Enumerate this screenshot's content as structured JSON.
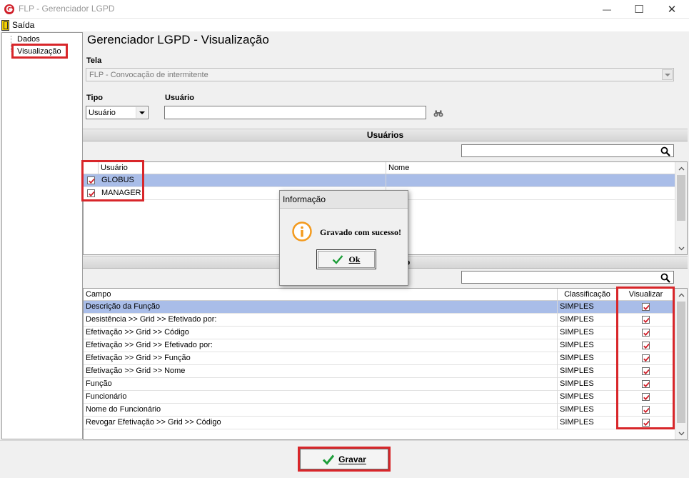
{
  "window": {
    "title": "FLP - Gerenciador LGPD",
    "minimize_glyph": "—",
    "maximize_glyph": "☐",
    "close_glyph": "✕"
  },
  "menu": {
    "exit_label": "Saída"
  },
  "tree": {
    "items": [
      {
        "label": "Dados"
      },
      {
        "label": "Visualização"
      }
    ]
  },
  "form": {
    "page_title": "Gerenciador LGPD - Visualização",
    "tela_label": "Tela",
    "tela_value": "FLP - Convocação de intermitente",
    "tipo_label": "Tipo",
    "tipo_value": "Usuário",
    "usuario_label": "Usuário",
    "usuario_value": ""
  },
  "users_section": {
    "title": "Usuários",
    "search_value": "",
    "columns": {
      "usuario": "Usuário",
      "nome": "Nome"
    },
    "rows": [
      {
        "usuario": "GLOBUS",
        "nome": "",
        "checked": true,
        "selected": true
      },
      {
        "usuario": "MANAGER",
        "nome": "",
        "checked": true,
        "selected": false
      }
    ]
  },
  "fields_section": {
    "title_fragment": "o",
    "search_value": "",
    "columns": {
      "campo": "Campo",
      "classificacao": "Classificação",
      "visualizar": "Visualizar"
    },
    "rows": [
      {
        "campo": "Descrição da Função",
        "classificacao": "SIMPLES",
        "visualizar": true
      },
      {
        "campo": "Desistência >> Grid >> Efetivado por:",
        "classificacao": "SIMPLES",
        "visualizar": true
      },
      {
        "campo": "Efetivação >> Grid >> Código",
        "classificacao": "SIMPLES",
        "visualizar": true
      },
      {
        "campo": "Efetivação >> Grid >> Efetivado por:",
        "classificacao": "SIMPLES",
        "visualizar": true
      },
      {
        "campo": "Efetivação >> Grid >> Função",
        "classificacao": "SIMPLES",
        "visualizar": true
      },
      {
        "campo": "Efetivação >> Grid >> Nome",
        "classificacao": "SIMPLES",
        "visualizar": true
      },
      {
        "campo": "Função",
        "classificacao": "SIMPLES",
        "visualizar": true
      },
      {
        "campo": "Funcionário",
        "classificacao": "SIMPLES",
        "visualizar": true
      },
      {
        "campo": "Nome do Funcionário",
        "classificacao": "SIMPLES",
        "visualizar": true
      },
      {
        "campo": "Revogar Efetivação >> Grid >> Código",
        "classificacao": "SIMPLES",
        "visualizar": true
      }
    ]
  },
  "dialog": {
    "title": "Informação",
    "message": "Gravado com sucesso!",
    "ok_label": "Ok"
  },
  "actions": {
    "save_label": "Gravar"
  },
  "colors": {
    "highlight_red": "#d8262a",
    "selection_blue": "#a9bde8",
    "check_red": "#d0202a",
    "info_orange": "#f39a1e",
    "ok_green": "#1e9e3a"
  }
}
